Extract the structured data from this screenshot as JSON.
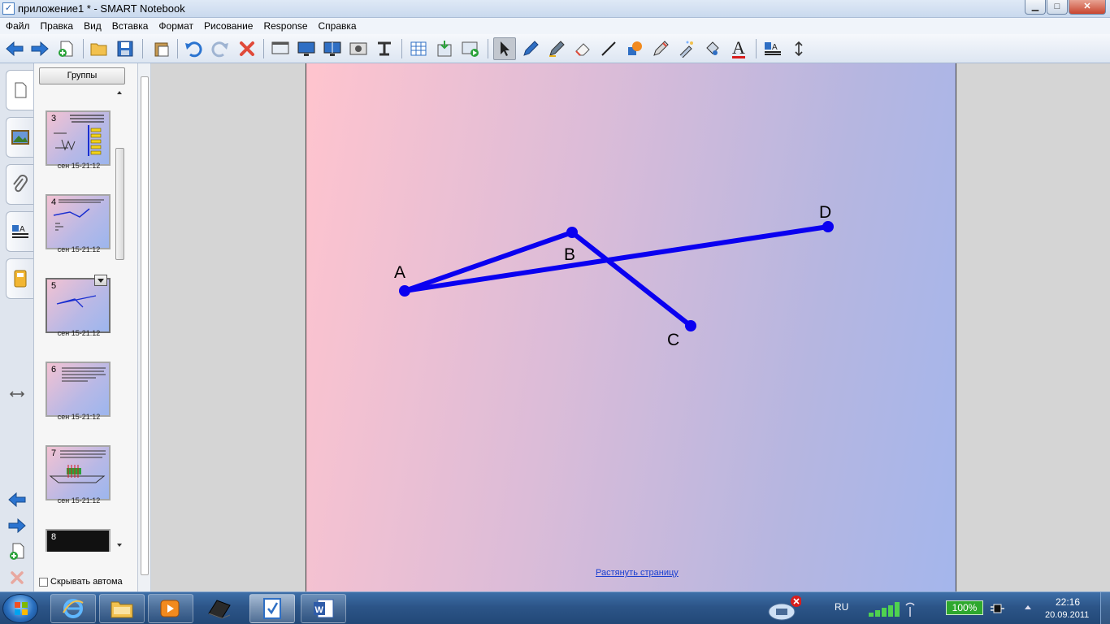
{
  "window": {
    "title": "приложение1 * - SMART Notebook",
    "minimize_glyph": "▁",
    "maximize_glyph": "□",
    "close_glyph": "✕"
  },
  "menu": [
    "Файл",
    "Правка",
    "Вид",
    "Вставка",
    "Формат",
    "Рисование",
    "Response",
    "Справка"
  ],
  "toolbar": {
    "icons": [
      "back-arrow-icon",
      "forward-arrow-icon",
      "new-page-icon",
      "open-folder-icon",
      "save-icon",
      "paste-icon",
      "undo-icon",
      "redo-icon",
      "delete-icon",
      "screen-shade-icon",
      "full-screen-icon",
      "dual-page-icon",
      "screen-capture-icon",
      "document-camera-icon",
      "table-icon",
      "insert-response-icon",
      "display-response-icon",
      "select-arrow-icon",
      "pen-icon",
      "creative-pen-icon",
      "eraser-icon",
      "line-icon",
      "shape-icon",
      "magic-pen-icon",
      "fill-icon",
      "text-icon",
      "properties-icon",
      "toolbar-position-icon"
    ],
    "text_tool_glyph": "A"
  },
  "sidebar": {
    "tabs": [
      "page-sorter-tab-icon",
      "gallery-tab-icon",
      "attachments-tab-icon",
      "properties-tab-icon",
      "addons-tab-icon"
    ],
    "groups_button": "Группы",
    "thumbnails": [
      {
        "num": "3",
        "caption": "сен 15-21:12"
      },
      {
        "num": "4",
        "caption": "сен 15-21:12"
      },
      {
        "num": "5",
        "caption": "сен 15-21:12"
      },
      {
        "num": "6",
        "caption": "сен 15-21:12"
      },
      {
        "num": "7",
        "caption": "сен 15-21:12"
      },
      {
        "num": "8",
        "caption": ""
      }
    ],
    "selected_page": "5",
    "hide_auto_label": "Скрывать автома"
  },
  "canvas": {
    "points": [
      {
        "label": "A"
      },
      {
        "label": "B"
      },
      {
        "label": "C"
      },
      {
        "label": "D"
      }
    ],
    "segments": [
      "AD",
      "AB",
      "BC"
    ],
    "line_color": "#0a00f0",
    "stretch_link": "Растянуть страницу"
  },
  "taskbar": {
    "apps": [
      "internet-explorer-icon",
      "file-explorer-icon",
      "media-player-icon",
      "laptop-icon",
      "smart-notebook-icon",
      "word-icon"
    ],
    "active_app": "smart-notebook-icon",
    "language": "RU",
    "battery": "100%",
    "time": "22:16",
    "date": "20.09.2011"
  }
}
